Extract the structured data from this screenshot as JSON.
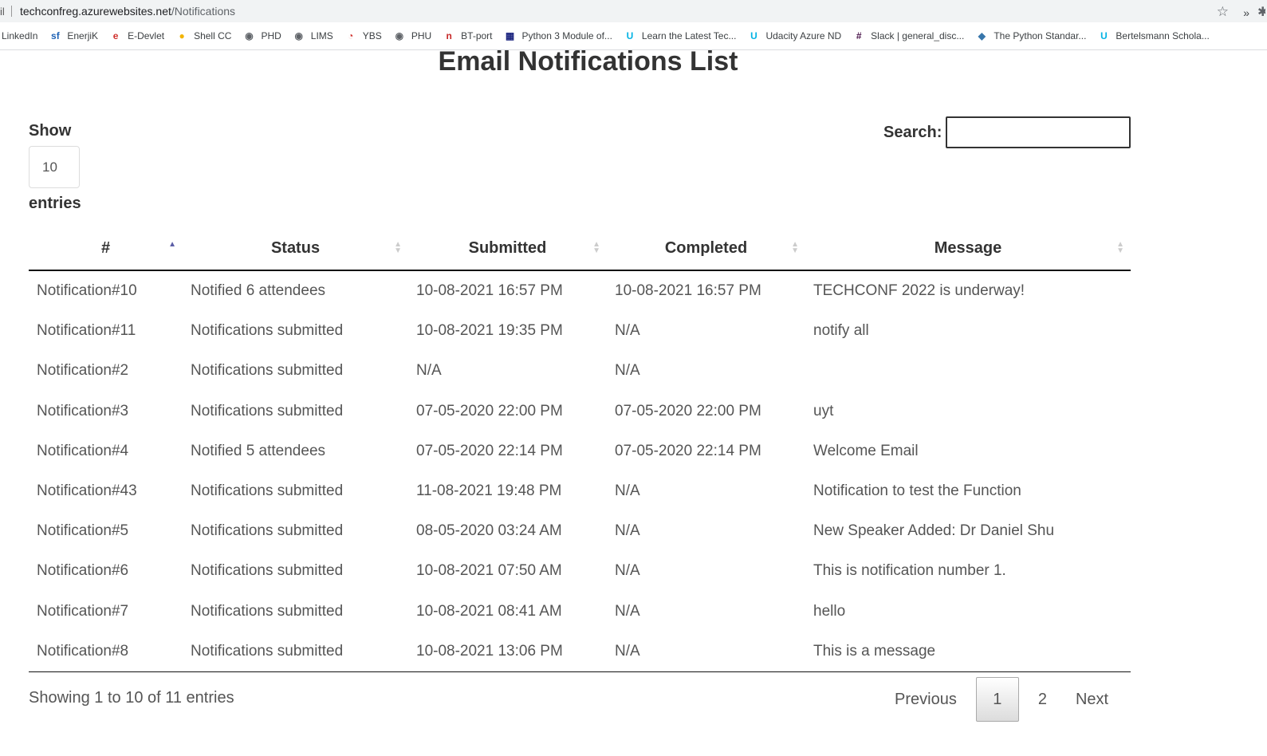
{
  "browser": {
    "address_prefix": "il",
    "url_host": "techconfreg.azurewebsites.net",
    "url_path": "/Notifications",
    "bookmarks": [
      {
        "label": "LinkedIn",
        "icon": "linkedin-icon",
        "glyph": "",
        "color": "#0a66c2"
      },
      {
        "label": "EnerjiK",
        "icon": "sf-icon",
        "glyph": "sf",
        "color": "#1e62b5"
      },
      {
        "label": "E-Devlet",
        "icon": "edevlet-icon",
        "glyph": "e",
        "color": "#d0312d"
      },
      {
        "label": "Shell CC",
        "icon": "shell-icon",
        "glyph": "●",
        "color": "#f2b400"
      },
      {
        "label": "PHD",
        "icon": "globe-icon",
        "glyph": "◉",
        "color": "#5f6368"
      },
      {
        "label": "LIMS",
        "icon": "globe-icon",
        "glyph": "◉",
        "color": "#5f6368"
      },
      {
        "label": "YBS",
        "icon": "ybs-icon",
        "glyph": "◔",
        "color": "#d0312d"
      },
      {
        "label": "PHU",
        "icon": "globe-icon",
        "glyph": "◉",
        "color": "#5f6368"
      },
      {
        "label": "BT-port",
        "icon": "btport-icon",
        "glyph": "n",
        "color": "#c62828"
      },
      {
        "label": "Python 3 Module of...",
        "icon": "pymotw-icon",
        "glyph": "▦",
        "color": "#1a237e"
      },
      {
        "label": "Learn the Latest Tec...",
        "icon": "udacity-icon",
        "glyph": "U",
        "color": "#02b3e4"
      },
      {
        "label": "Udacity Azure ND",
        "icon": "udacity-icon",
        "glyph": "U",
        "color": "#02b3e4"
      },
      {
        "label": "Slack | general_disc...",
        "icon": "slack-icon",
        "glyph": "#",
        "color": "#4a154b"
      },
      {
        "label": "The Python Standar...",
        "icon": "python-icon",
        "glyph": "◆",
        "color": "#3776ab"
      },
      {
        "label": "Bertelsmann Schola...",
        "icon": "udacity-icon",
        "glyph": "U",
        "color": "#02b3e4"
      }
    ],
    "more_glyph": "»"
  },
  "page": {
    "title": "Email Notifications List",
    "length": {
      "show_label": "Show",
      "value": "10",
      "entries_label": "entries"
    },
    "search": {
      "label": "Search:",
      "value": ""
    },
    "table": {
      "columns": [
        "#",
        "Status",
        "Submitted",
        "Completed",
        "Message"
      ],
      "sorted_column": "#",
      "sort_direction": "ascending",
      "rows": [
        [
          "Notification#10",
          "Notified 6 attendees",
          "10-08-2021 16:57 PM",
          "10-08-2021 16:57 PM",
          "TECHCONF 2022 is underway!"
        ],
        [
          "Notification#11",
          "Notifications submitted",
          "10-08-2021 19:35 PM",
          "N/A",
          "notify all"
        ],
        [
          "Notification#2",
          "Notifications submitted",
          "N/A",
          "N/A",
          ""
        ],
        [
          "Notification#3",
          "Notifications submitted",
          "07-05-2020 22:00 PM",
          "07-05-2020 22:00 PM",
          "uyt"
        ],
        [
          "Notification#4",
          "Notified 5 attendees",
          "07-05-2020 22:14 PM",
          "07-05-2020 22:14 PM",
          "Welcome Email"
        ],
        [
          "Notification#43",
          "Notifications submitted",
          "11-08-2021 19:48 PM",
          "N/A",
          "Notification to test the Function"
        ],
        [
          "Notification#5",
          "Notifications submitted",
          "08-05-2020 03:24 AM",
          "N/A",
          "New Speaker Added: Dr Daniel Shu"
        ],
        [
          "Notification#6",
          "Notifications submitted",
          "10-08-2021 07:50 AM",
          "N/A",
          "This is notification number 1."
        ],
        [
          "Notification#7",
          "Notifications submitted",
          "10-08-2021 08:41 AM",
          "N/A",
          "hello"
        ],
        [
          "Notification#8",
          "Notifications submitted",
          "10-08-2021 13:06 PM",
          "N/A",
          "This is a message"
        ]
      ]
    },
    "info": "Showing 1 to 10 of 11 entries",
    "pagination": {
      "previous": "Previous",
      "pages": [
        "1",
        "2"
      ],
      "current": "1",
      "next": "Next"
    }
  }
}
